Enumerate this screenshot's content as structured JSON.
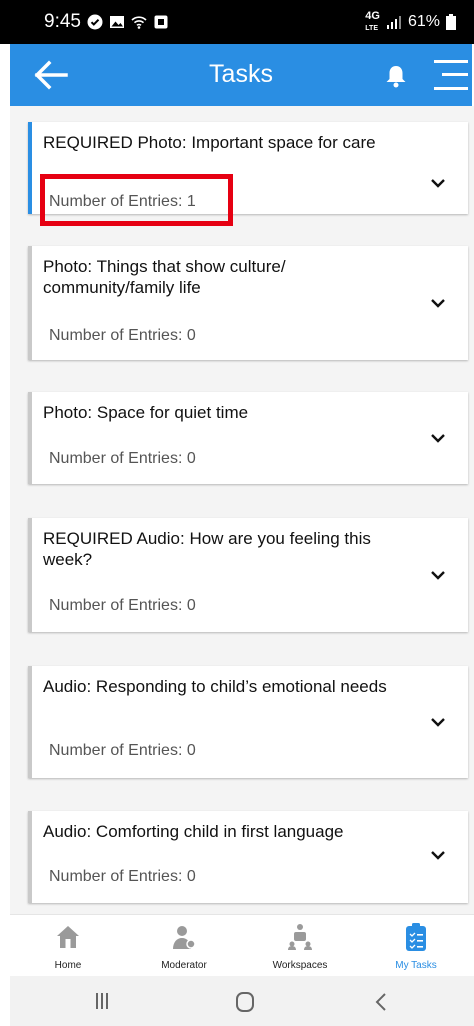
{
  "status_bar": {
    "time": "9:45",
    "network": "4G",
    "network_sub": "LTE",
    "battery": "61%"
  },
  "header": {
    "title": "Tasks",
    "icons": [
      "back-arrow-icon",
      "bell-icon",
      "menu-icon"
    ],
    "color": "#2a8ee3"
  },
  "tasks": [
    {
      "title": "REQUIRED Photo: Important space for care",
      "entries": "Number of Entries: 1",
      "highlighted": true
    },
    {
      "title": "Photo: Things that show culture/ community/family life",
      "entries": "Number of Entries: 0"
    },
    {
      "title": "Photo: Space for quiet time",
      "entries": "Number of Entries: 0"
    },
    {
      "title": "REQUIRED Audio: How are you feeling this week?",
      "entries": "Number of Entries: 0"
    },
    {
      "title": "Audio: Responding to child’s emotional needs",
      "entries": "Number of Entries: 0"
    },
    {
      "title": "Audio: Comforting child in first language",
      "entries": "Number of Entries: 0"
    }
  ],
  "bottom_nav": {
    "items": [
      {
        "label": "Home",
        "icon": "home-icon"
      },
      {
        "label": "Moderator",
        "icon": "moderator-icon"
      },
      {
        "label": "Workspaces",
        "icon": "workspaces-icon"
      },
      {
        "label": "My Tasks",
        "icon": "clipboard-icon",
        "active": true
      }
    ]
  },
  "system_nav": [
    "recent-apps-icon",
    "home-button-icon",
    "back-button-icon"
  ]
}
